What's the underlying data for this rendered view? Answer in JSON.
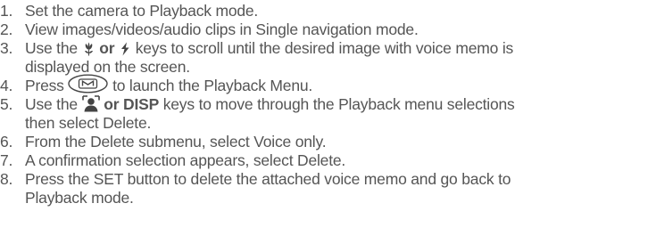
{
  "steps": [
    {
      "num": "1.",
      "text": "Set the camera to Playback mode."
    },
    {
      "num": "2.",
      "text": "View images/videos/audio clips in Single navigation mode."
    },
    {
      "num": "3.",
      "pre": "Use the ",
      "key_or": "or",
      "post": " keys to scroll until the desired image with voice memo is",
      "cont": "displayed on the screen."
    },
    {
      "num": "4.",
      "pre": "Press ",
      "post": " to launch the Playback Menu."
    },
    {
      "num": "5.",
      "pre": "Use the ",
      "key_or_disp": "or DISP",
      "post": " keys to move through the Playback menu selections",
      "cont": "then select Delete."
    },
    {
      "num": "6.",
      "text": "From the Delete submenu, select Voice only."
    },
    {
      "num": "7.",
      "text": "A confirmation selection appears, select Delete."
    },
    {
      "num": "8.",
      "text": "Press the SET button to delete the attached voice memo and go back to",
      "cont": "Playback mode."
    }
  ],
  "icons": {
    "step3_left": "macro-flower-icon",
    "step3_right": "flash-bolt-icon",
    "step4": "menu-m-button-icon",
    "step5": "face-detection-icon"
  },
  "colors": {
    "text": "#555555",
    "icon": "#444444"
  }
}
